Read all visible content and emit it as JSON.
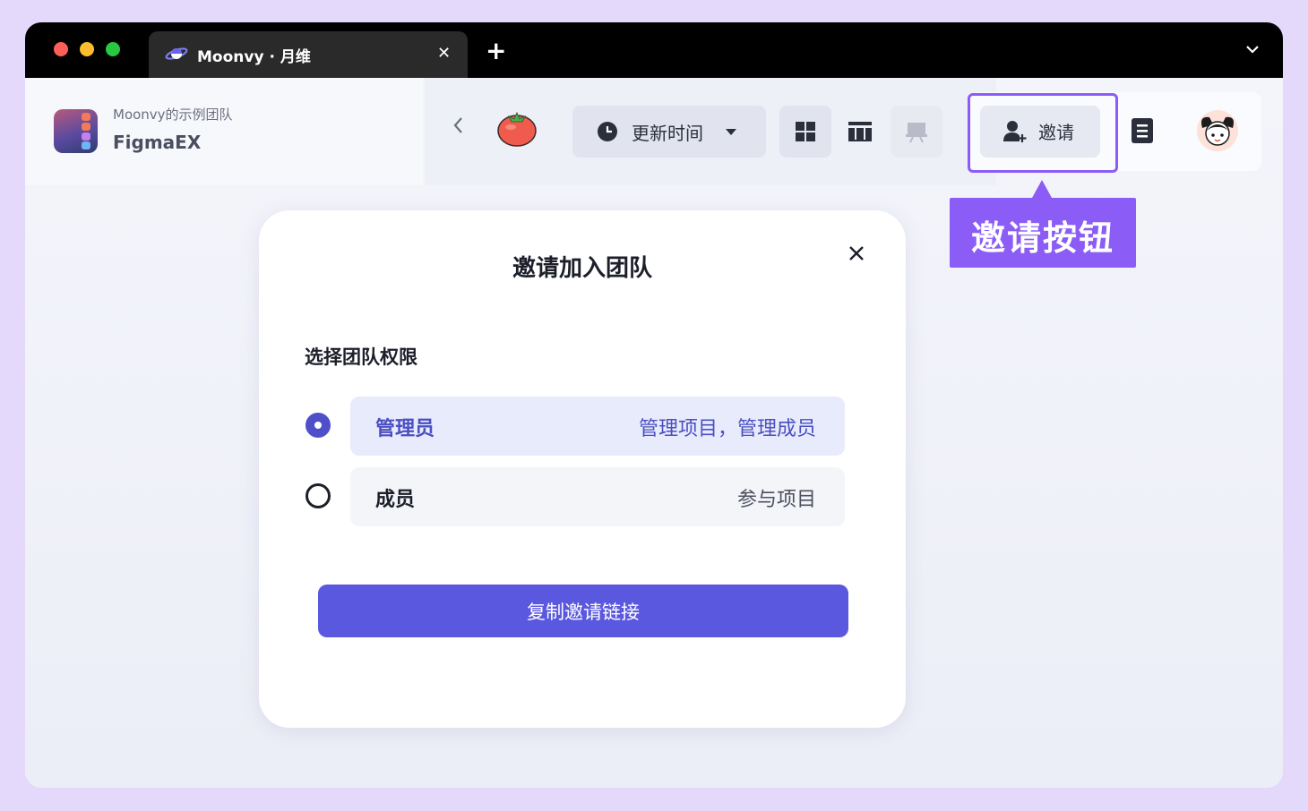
{
  "browser": {
    "tab_title": "Moonvy · 月维",
    "tab_close": "✕",
    "new_tab": "+"
  },
  "sidebar": {
    "team_name": "Moonvy的示例团队",
    "project_name": "FigmaEX"
  },
  "toolbar": {
    "sort_label": "更新时间",
    "invite_label": "邀请"
  },
  "callout": {
    "text": "邀请按钮"
  },
  "modal": {
    "title": "邀请加入团队",
    "close": "✕",
    "section_label": "选择团队权限",
    "options": [
      {
        "name": "管理员",
        "description": "管理项目，管理成员",
        "selected": true
      },
      {
        "name": "成员",
        "description": "参与项目",
        "selected": false
      }
    ],
    "copy_button": "复制邀请链接"
  },
  "colors": {
    "accent": "#5b58e0",
    "callout": "#8b5cf6",
    "selected_text": "#4a4fc2"
  }
}
